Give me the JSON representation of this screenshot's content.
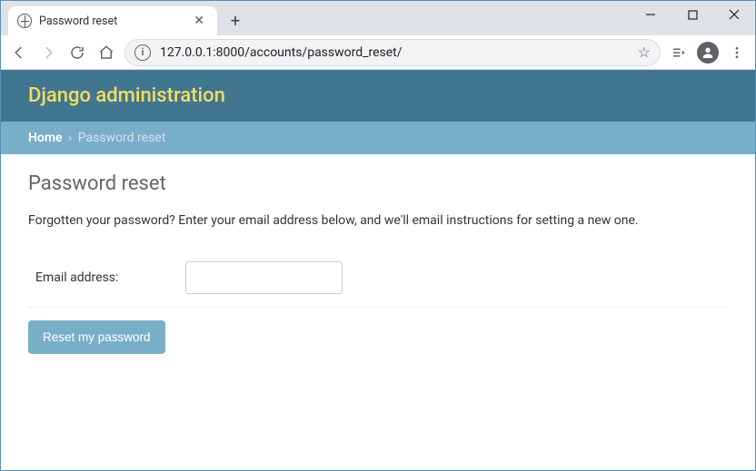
{
  "window": {
    "tab_title": "Password reset"
  },
  "toolbar": {
    "url": "127.0.0.1:8000/accounts/password_reset/"
  },
  "header": {
    "branding": "Django administration"
  },
  "breadcrumb": {
    "home": "Home",
    "separator": "›",
    "current": "Password reset"
  },
  "content": {
    "heading": "Password reset",
    "helptext": "Forgotten your password? Enter your email address below, and we'll email instructions for setting a new one.",
    "email_label": "Email address:",
    "email_value": "",
    "submit_label": "Reset my password"
  }
}
